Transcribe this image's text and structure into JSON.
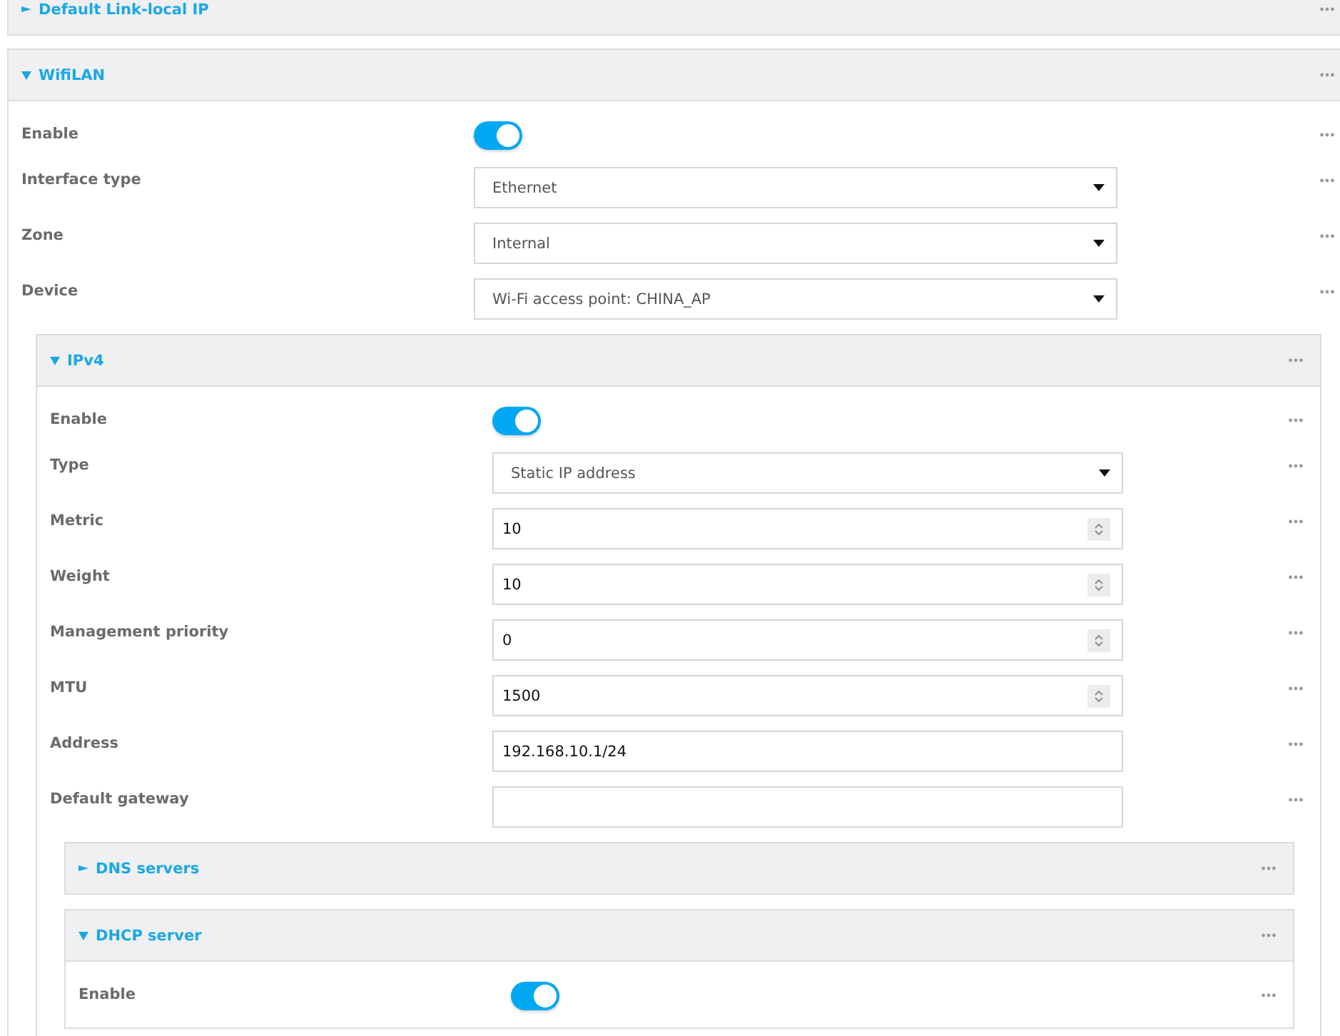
{
  "sections": [
    {
      "title": "Default Link-local IP",
      "expanded": false
    },
    {
      "title": "WifiLAN",
      "expanded": true,
      "rows": [
        {
          "kind": "toggle",
          "label": "Enable",
          "on": true
        },
        {
          "kind": "select",
          "label": "Interface type",
          "value": "Ethernet"
        },
        {
          "kind": "select",
          "label": "Zone",
          "value": "Internal"
        },
        {
          "kind": "select",
          "label": "Device",
          "value": "Wi-Fi access point: CHINA_AP"
        }
      ],
      "sections": [
        {
          "title": "IPv4",
          "expanded": true,
          "rows": [
            {
              "kind": "toggle",
              "label": "Enable",
              "on": true
            },
            {
              "kind": "select",
              "label": "Type",
              "value": "Static IP address"
            },
            {
              "kind": "number",
              "label": "Metric",
              "value": "10"
            },
            {
              "kind": "number",
              "label": "Weight",
              "value": "10"
            },
            {
              "kind": "number",
              "label": "Management priority",
              "value": "0"
            },
            {
              "kind": "number",
              "label": "MTU",
              "value": "1500"
            },
            {
              "kind": "text",
              "label": "Address",
              "value": "192.168.10.1/24"
            },
            {
              "kind": "text",
              "label": "Default gateway"
            }
          ],
          "sections": [
            {
              "title": "DNS servers",
              "expanded": false
            },
            {
              "title": "DHCP server",
              "expanded": true,
              "rows": [
                {
                  "kind": "toggle",
                  "label": "Enable",
                  "on": true
                }
              ]
            }
          ]
        }
      ]
    }
  ]
}
